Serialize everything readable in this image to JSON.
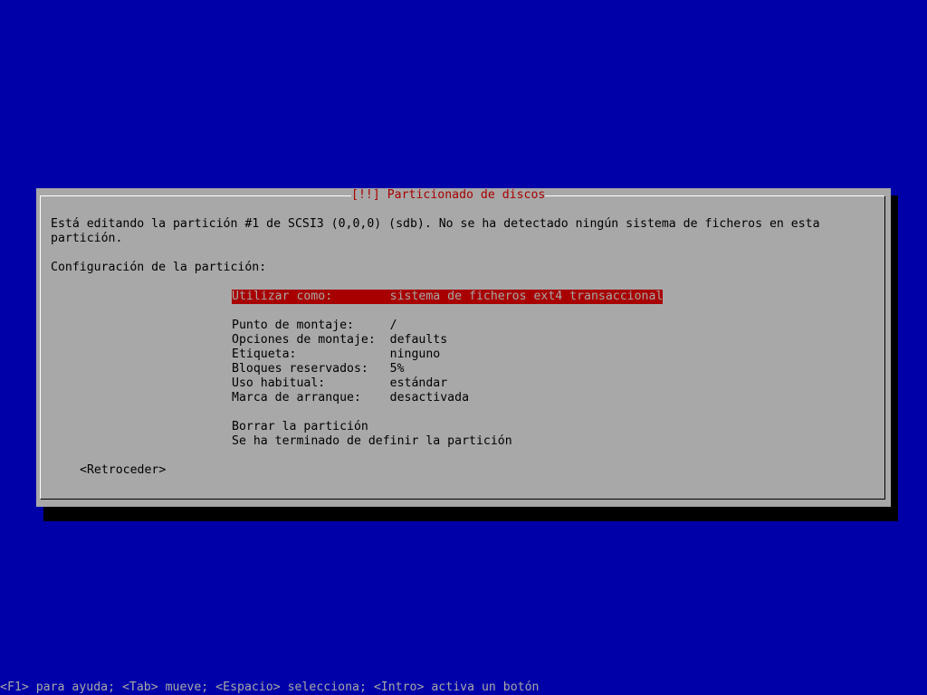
{
  "dialog": {
    "title": "[!!] Particionado de discos",
    "description_line1": "Está editando la partición #1 de SCSI3 (0,0,0) (sdb). No se ha detectado ningún sistema de ficheros en esta",
    "description_line2": "partición.",
    "section_heading": "Configuración de la partición:",
    "selected_option": "Utilizar como:        sistema de ficheros ext4 transaccional",
    "settings": [
      "Punto de montaje:     /",
      "Opciones de montaje:  defaults",
      "Etiqueta:             ninguno",
      "Bloques reservados:   5%",
      "Uso habitual:         estándar",
      "Marca de arranque:    desactivada"
    ],
    "actions": [
      "Borrar la partición",
      "Se ha terminado de definir la partición"
    ],
    "back_button": "<Retroceder>"
  },
  "help_bar": "<F1> para ayuda; <Tab> mueve; <Espacio> selecciona; <Intro> activa un botón",
  "colors": {
    "background": "#0000a8",
    "dialog": "#a8a8a8",
    "title": "#a80000",
    "selection": "#a80000"
  }
}
